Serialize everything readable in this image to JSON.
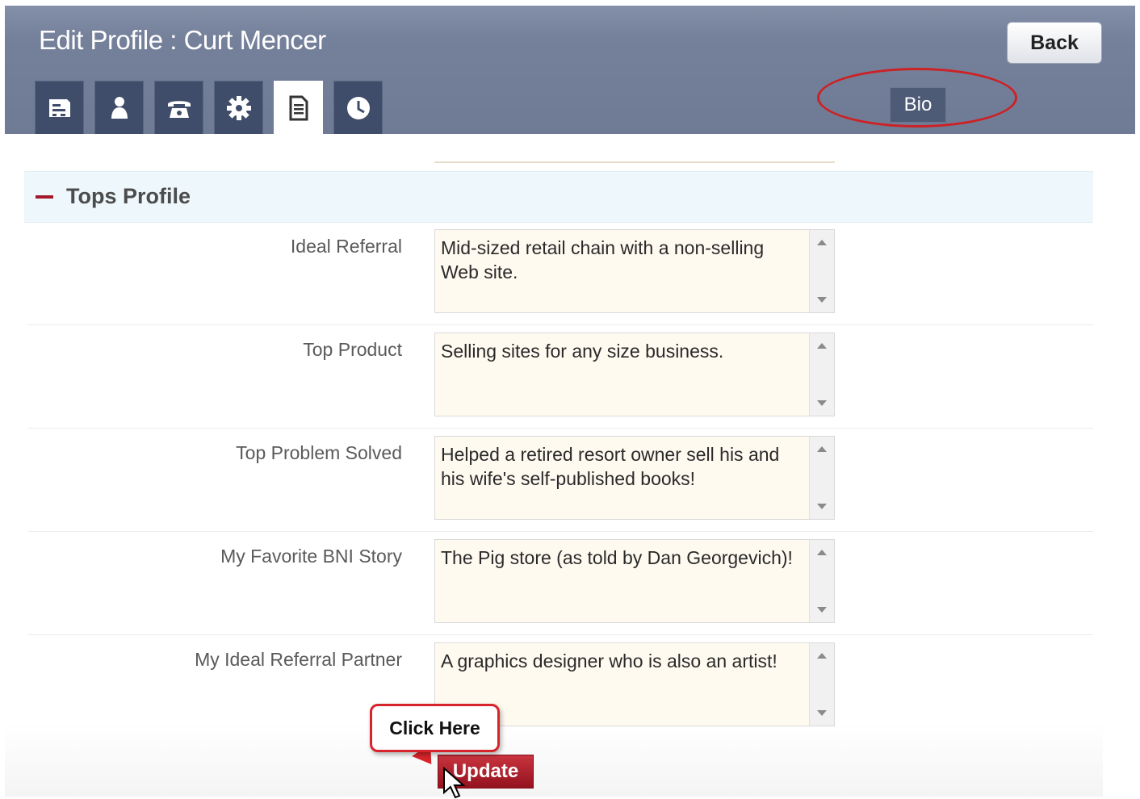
{
  "header": {
    "title": "Edit Profile : Curt Mencer",
    "back_label": "Back",
    "current_tab_label": "Bio",
    "tabs": [
      {
        "icon": "company-icon"
      },
      {
        "icon": "person-icon"
      },
      {
        "icon": "phone-icon"
      },
      {
        "icon": "gear-icon"
      },
      {
        "icon": "document-icon",
        "active": true
      },
      {
        "icon": "clock-icon"
      }
    ]
  },
  "section": {
    "title": "Tops Profile",
    "fields": [
      {
        "label": "Ideal Referral",
        "value": "Mid-sized retail chain with a non-selling Web site."
      },
      {
        "label": "Top Product",
        "value": "Selling sites for any size business."
      },
      {
        "label": "Top Problem Solved",
        "value": "Helped a retired resort owner sell his and his wife's self-published books!"
      },
      {
        "label": "My Favorite BNI Story",
        "value": "The Pig store (as told by Dan Georgevich)!"
      },
      {
        "label": "My Ideal Referral Partner",
        "value": "A graphics designer who is also an artist!"
      }
    ]
  },
  "update_label": "Update",
  "callout_label": "Click Here",
  "colors": {
    "header": "#75819b",
    "accent": "#a1192a",
    "highlight": "#cc2125",
    "textarea_bg": "#fffaf0"
  }
}
